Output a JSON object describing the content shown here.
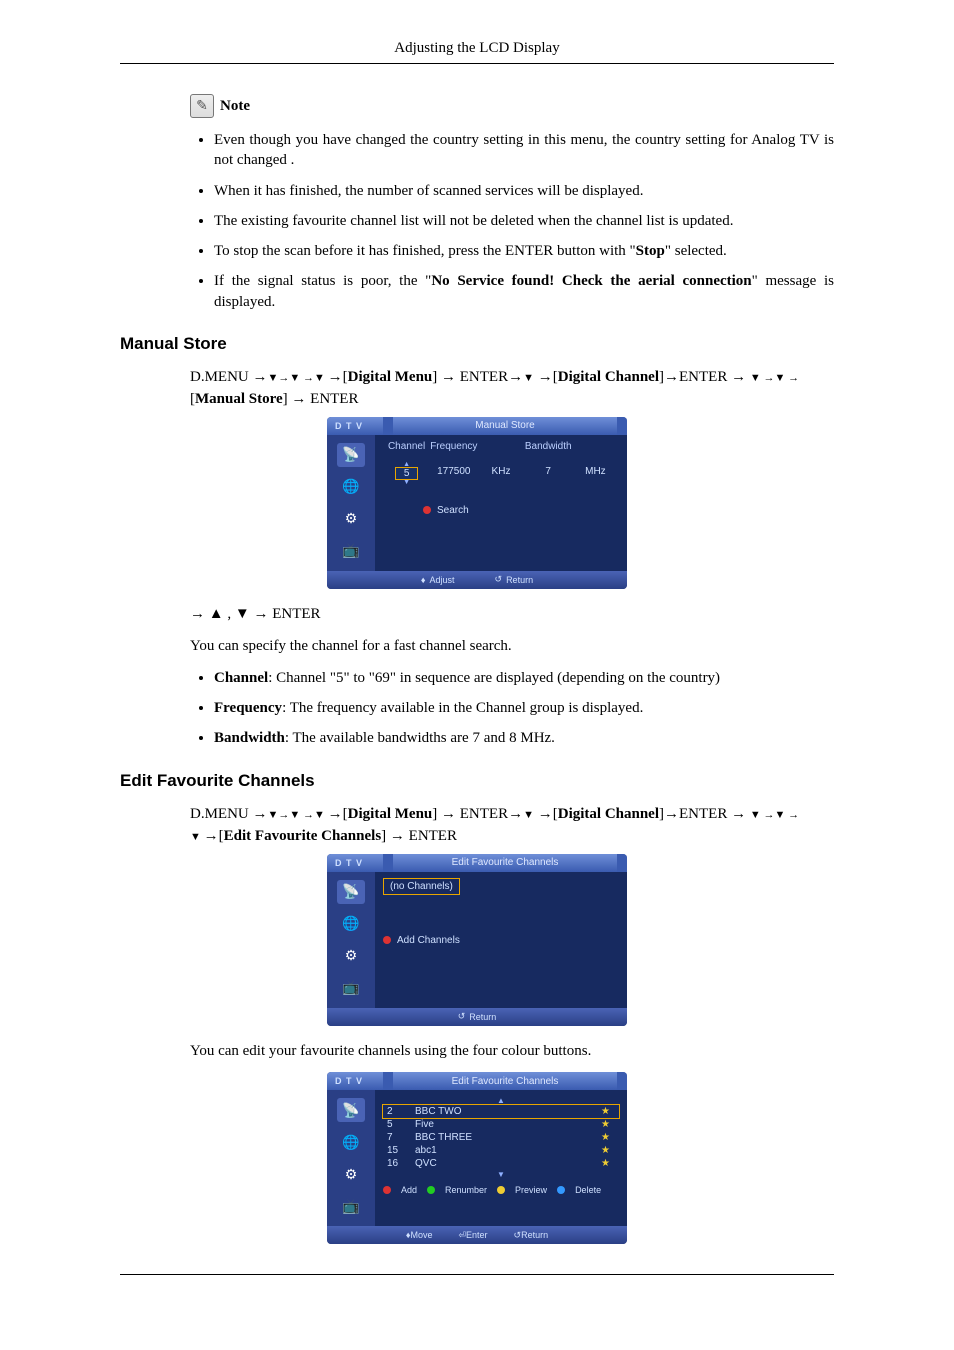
{
  "header": {
    "title": "Adjusting the LCD Display"
  },
  "note": {
    "label": "Note"
  },
  "notes_list": [
    "Even though you have changed the country setting in this menu, the country setting for Analog TV is not changed .",
    "When it has finished, the number of scanned services will be displayed.",
    "The existing favourite channel list will not be deleted when the channel list is updated.",
    "To stop the scan before it has finished, press the ENTER button with \"Stop\" selected.",
    "If the signal status is poor, the \"No Service found! Check the aerial connection\" message is displayed."
  ],
  "manual_store": {
    "heading": "Manual Store",
    "nav_prefix": "D.MENU →",
    "nav_mid1": "→[",
    "nav_dm": "Digital Menu",
    "nav_mid2": "] → ENTER→",
    "nav_mid3": " →[",
    "nav_dc": "Digital Channel",
    "nav_mid4": "]→ENTER → ",
    "nav_tail": " → [",
    "nav_ms": "Manual Store",
    "nav_end": "] → ENTER",
    "osd": {
      "dtv": "D T V",
      "title": "Manual Store",
      "cols": {
        "channel": "Channel",
        "frequency": "Frequency",
        "bandwidth": "Bandwidth"
      },
      "row": {
        "channel": "5",
        "freq_val": "177500",
        "freq_unit": "KHz",
        "bw_val": "7",
        "bw_unit": "MHz"
      },
      "search": "Search",
      "foot_adjust": "Adjust",
      "foot_return": "Return"
    },
    "after_osd_nav": "→ ▲ , ▼ → ENTER",
    "desc": "You can specify the channel for a fast channel search.",
    "items": [
      {
        "label": "Channel",
        "text": ": Channel \"5\" to \"69\" in sequence are displayed (depending on the country)"
      },
      {
        "label": "Frequency",
        "text": ": The frequency available in the Channel group is displayed."
      },
      {
        "label": "Bandwidth",
        "text": ": The available bandwidths are 7 and 8 MHz."
      }
    ]
  },
  "edit_fav": {
    "heading": "Edit Favourite Channels",
    "nav_prefix": "D.MENU →",
    "nav_mid1": "→[",
    "nav_dm": "Digital Menu",
    "nav_mid2": "] → ENTER→",
    "nav_mid3": " →[",
    "nav_dc": "Digital Channel",
    "nav_mid4": "]→ENTER → ",
    "nav_tail": " →[",
    "nav_efc": "Edit Favourite Channels",
    "nav_end": "] → ENTER",
    "osd1": {
      "dtv": "D T V",
      "title": "Edit Favourite Channels",
      "no_channels": "(no Channels)",
      "add_channels": "Add Channels",
      "foot_return": "Return"
    },
    "desc": "You can edit your favourite channels using the four colour buttons.",
    "osd2": {
      "dtv": "D T V",
      "title": "Edit Favourite Channels",
      "rows": [
        {
          "num": "2",
          "name": "BBC TWO",
          "sel": true
        },
        {
          "num": "5",
          "name": "Five",
          "sel": false
        },
        {
          "num": "7",
          "name": "BBC THREE",
          "sel": false
        },
        {
          "num": "15",
          "name": "abc1",
          "sel": false
        },
        {
          "num": "16",
          "name": "QVC",
          "sel": false
        }
      ],
      "actions": {
        "add": "Add",
        "renumber": "Renumber",
        "preview": "Preview",
        "delete": "Delete"
      },
      "foot": {
        "move": "Move",
        "enter": "Enter",
        "return": "Return"
      }
    }
  },
  "bold_words": {
    "stop": "Stop",
    "no_service": "No Service found! Check the aerial connection"
  }
}
